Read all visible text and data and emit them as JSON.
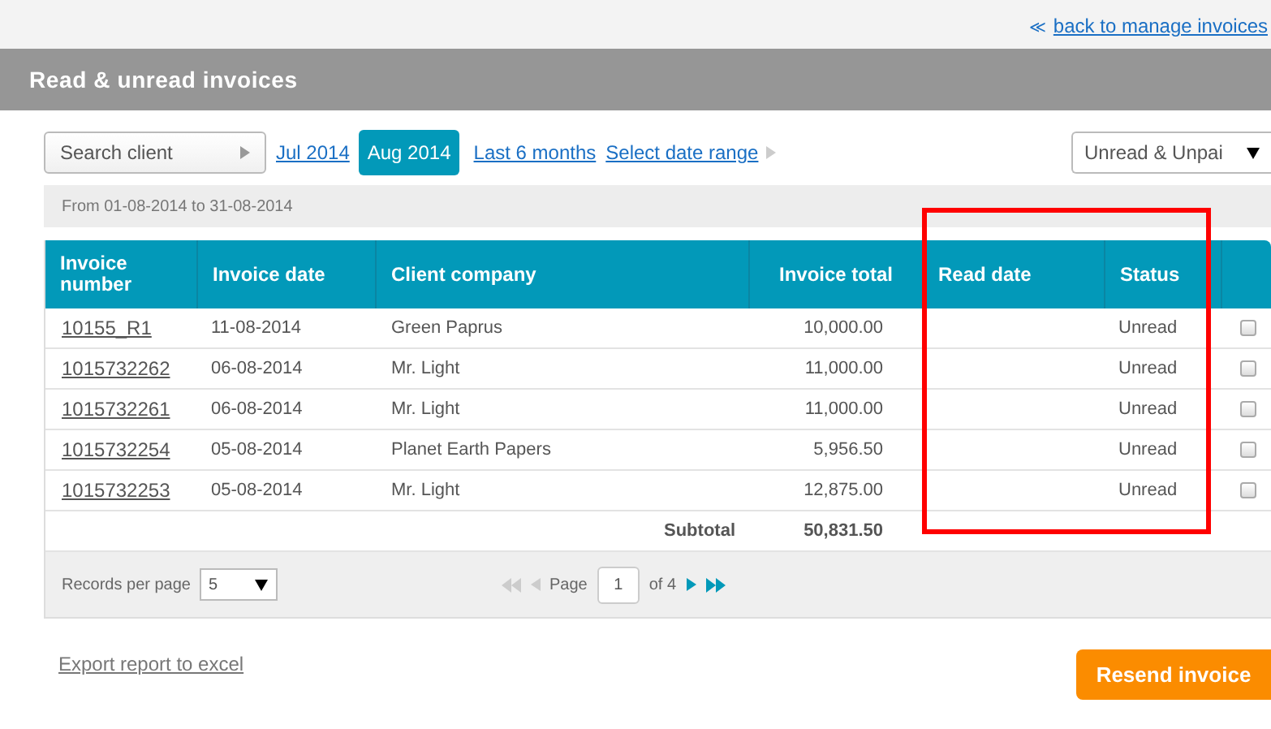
{
  "back_link": {
    "icon": "≪",
    "label": "back to manage invoices"
  },
  "title": "Read & unread invoices",
  "search": {
    "placeholder": "Search client"
  },
  "periods": [
    {
      "label": "Jul 2014",
      "selected": false
    },
    {
      "label": "Aug 2014",
      "selected": true
    },
    {
      "label": "Last 6 months",
      "selected": false
    },
    {
      "label": "Select date range",
      "selected": false
    }
  ],
  "filter": {
    "value": "Unread & Unpai"
  },
  "range_text": "From 01-08-2014 to 31-08-2014",
  "table": {
    "columns": [
      "Invoice number",
      "Invoice date",
      "Client company",
      "Invoice total",
      "Read date",
      "Status"
    ],
    "rows": [
      {
        "number": "10155_R1",
        "date": "11-08-2014",
        "company": "Green Paprus",
        "total": "10,000.00",
        "status": "Unread",
        "checked": false
      },
      {
        "number": "1015732262",
        "date": "06-08-2014",
        "company": "Mr. Light",
        "total": "11,000.00",
        "status": "Unread",
        "checked": false
      },
      {
        "number": "1015732261",
        "date": "06-08-2014",
        "company": "Mr. Light",
        "total": "11,000.00",
        "status": "Unread",
        "checked": false
      },
      {
        "number": "1015732254",
        "date": "05-08-2014",
        "company": "Planet Earth Papers",
        "total": "5,956.50",
        "status": "Unread",
        "checked": false
      },
      {
        "number": "1015732253",
        "date": "05-08-2014",
        "company": "Mr. Light",
        "total": "12,875.00",
        "status": "Unread",
        "checked": false
      }
    ],
    "subtotal_label": "Subtotal",
    "subtotal": "50,831.50"
  },
  "pager": {
    "records_label": "Records per page",
    "records_value": "5",
    "page_label": "Page",
    "page": "1",
    "of": "of 4"
  },
  "export_link": "Export report to excel",
  "resend_button": "Resend invoice"
}
